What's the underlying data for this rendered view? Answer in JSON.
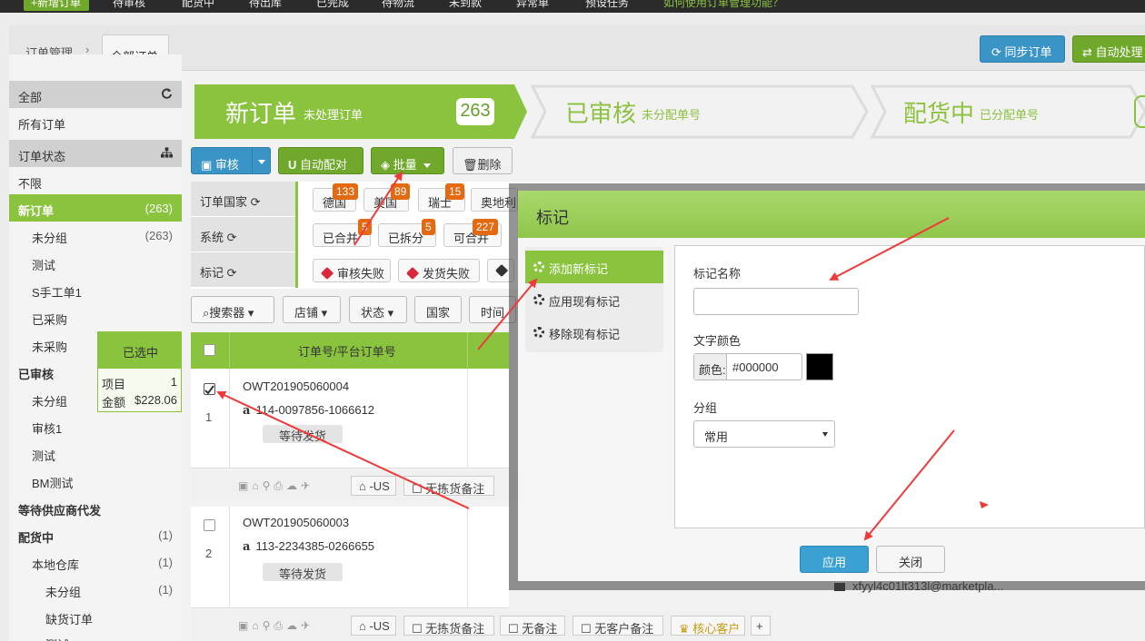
{
  "topbar": {
    "new_button": "+新增订单",
    "items": [
      "待审核",
      "配货中",
      "待出库",
      "已完成",
      "待物流",
      "未到款",
      "异常单",
      "预设任务",
      "如何使用订单管理功能？"
    ]
  },
  "breadcrumb": {
    "root": "订单管理",
    "separator": "›",
    "current": "全部订单"
  },
  "header_buttons": {
    "sync": "同步订单",
    "auto": "自动处理"
  },
  "sidebar": {
    "items": [
      {
        "label": "全部",
        "type": "head"
      },
      {
        "label": "所有订单",
        "type": "normal"
      },
      {
        "label": "订单状态",
        "type": "head"
      },
      {
        "label": "不限",
        "type": "normal"
      },
      {
        "label": "新订单",
        "count": "(263)",
        "type": "active"
      },
      {
        "label": "未分组",
        "count": "(263)",
        "type": "l1"
      },
      {
        "label": "测试",
        "type": "l1"
      },
      {
        "label": "S手工单1",
        "type": "l1"
      },
      {
        "label": "已采购",
        "type": "l1"
      },
      {
        "label": "未采购",
        "type": "l1"
      },
      {
        "label": "已审核",
        "type": "bold"
      },
      {
        "label": "未分组",
        "type": "l1"
      },
      {
        "label": "审核1",
        "type": "l1"
      },
      {
        "label": "测试",
        "type": "l1"
      },
      {
        "label": "BM测试",
        "type": "l1"
      },
      {
        "label": "等待供应商代发",
        "type": "bold"
      },
      {
        "label": "配货中",
        "count": "(1)",
        "type": "bold"
      },
      {
        "label": "本地仓库",
        "count": "(1)",
        "type": "l1"
      },
      {
        "label": "未分组",
        "count": "(1)",
        "type": "l2"
      },
      {
        "label": "缺货订单",
        "type": "l2"
      },
      {
        "label": "测试",
        "type": "l2"
      }
    ]
  },
  "steps": [
    {
      "title": "新订单",
      "sub": "未处理订单",
      "count": "263"
    },
    {
      "title": "已审核",
      "sub": "未分配单号"
    },
    {
      "title": "配货中",
      "sub": "已分配单号"
    }
  ],
  "toolbar": {
    "audit": "审核",
    "auto_match": "自动配对",
    "batch": "批量",
    "delete": "删除"
  },
  "filters": {
    "labels": [
      "订单国家",
      "系统",
      "标记"
    ],
    "countries": [
      {
        "name": "德国",
        "count": "133"
      },
      {
        "name": "美国",
        "count": "89"
      },
      {
        "name": "瑞士",
        "count": "15"
      },
      {
        "name": "奥地利",
        "count": ""
      }
    ],
    "system": [
      {
        "name": "已合并",
        "count": "5"
      },
      {
        "name": "已拆分",
        "count": "5"
      },
      {
        "name": "可合并",
        "count": "227"
      }
    ],
    "marks": [
      "审核失败",
      "发货失败"
    ]
  },
  "search_bar": [
    "搜索器",
    "店铺",
    "状态",
    "国家",
    "时间"
  ],
  "table": {
    "header": "订单号/平台订单号",
    "rows": [
      {
        "num": "1",
        "order": "OWT201905060004",
        "platform": "114-0097856-1066612",
        "status": "等待发货",
        "checked": true
      },
      {
        "num": "2",
        "order": "OWT201905060003",
        "platform": "113-2234385-0266655",
        "status": "等待发货",
        "checked": false
      }
    ],
    "foot_chips": [
      "-US",
      "无拣货备注",
      "无备注",
      "无客户备注",
      "核心客户"
    ]
  },
  "selected_popover": {
    "title": "已选中",
    "items_label": "项目",
    "items_value": "1",
    "amount_label": "金额",
    "amount_value": "$228.06"
  },
  "email": "xfyyl4c01lt313l@marketpla...",
  "modal": {
    "title": "标记",
    "nav": [
      "添加新标记",
      "应用现有标记",
      "移除现有标记"
    ],
    "name_label": "标记名称",
    "name_value": "",
    "color_label": "文字颜色",
    "color_prefix": "颜色:",
    "color_value": "#000000",
    "group_label": "分组",
    "group_value": "常用",
    "apply": "应用",
    "close": "关闭"
  },
  "colors": {
    "green": "#8ac43f",
    "blue": "#3b94c6",
    "orange": "#e46a12",
    "arrow": "#f03a3a"
  }
}
